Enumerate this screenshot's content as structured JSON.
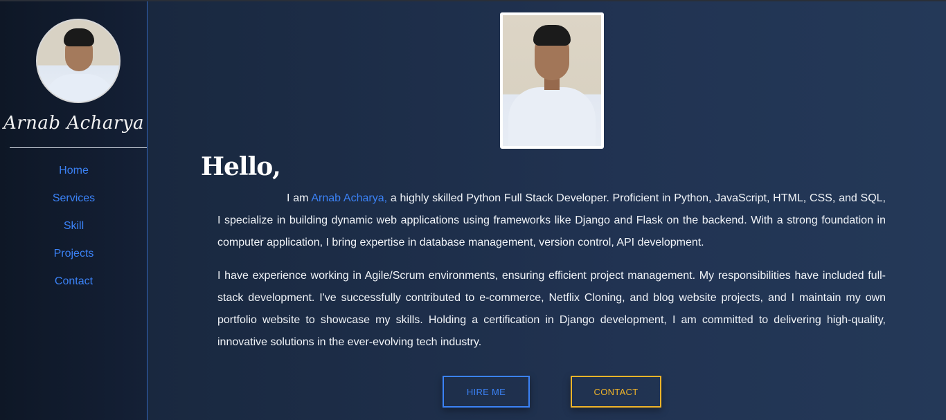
{
  "sidebar": {
    "name": "Arnab Acharya",
    "nav": [
      {
        "label": "Home"
      },
      {
        "label": "Services"
      },
      {
        "label": "Skill"
      },
      {
        "label": "Projects"
      },
      {
        "label": "Contact"
      }
    ]
  },
  "main": {
    "greeting": "Hello,",
    "intro_prefix": "I am ",
    "intro_name": "Arnab Acharya,",
    "intro_rest": " a highly skilled Python Full Stack Developer. Proficient in Python, JavaScript, HTML, CSS, and SQL, I specialize in building dynamic web applications using frameworks like Django and Flask on the backend. With a strong foundation in computer application, I bring expertise in database management, version control, API development.",
    "paragraph2": "I have experience working in Agile/Scrum environments, ensuring efficient project management. My responsibilities have included full-stack development. I've successfully contributed to e-commerce, Netflix Cloning, and blog website projects, and I maintain my own portfolio website to showcase my skills. Holding a certification in Django development, I am committed to delivering high-quality, innovative solutions in the ever-evolving tech industry.",
    "buttons": {
      "hire": "HIRE ME",
      "contact": "CONTACT"
    }
  },
  "colors": {
    "accent_blue": "#3b82f6",
    "accent_gold": "#f0b429",
    "background": "#1e2f4a"
  },
  "icons": [
    "profile-avatar",
    "profile-portrait"
  ]
}
